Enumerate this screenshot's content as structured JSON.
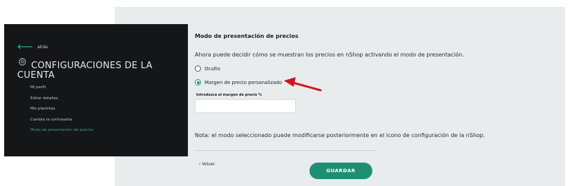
{
  "sidebar": {
    "back_label": "atrás",
    "title": "CONFIGURACIONES DE LA CUENTA",
    "menu": [
      {
        "label": "Mi perfil"
      },
      {
        "label": "Editar detalles"
      },
      {
        "label": "Mis plantillas"
      },
      {
        "label": "Cambia la contraseña"
      },
      {
        "label": "Modo de presentación de precios"
      }
    ],
    "active_index": 4
  },
  "main": {
    "section_title": "Modo de presentación de precios",
    "description": "Ahora puede decidir cómo se muestran los precios en nShop activando el modo de presentación.",
    "options": [
      {
        "label": "Oculto",
        "selected": false
      },
      {
        "label": "Margen de precio personalizado",
        "selected": true
      }
    ],
    "margin_field": {
      "label": "Introduzca el margen de precio %",
      "value": ""
    },
    "note": "Nota: el modo seleccionado puede modificarse posteriormente en el icono de configuración de la nShop.",
    "back_link": "Volver",
    "save_button": "GUARDAR"
  },
  "icons": {
    "back": "arrow-left-icon",
    "section": "gear-icon",
    "volver": "chevron-left-icon",
    "annotation": "red-pointer-arrow-icon"
  },
  "colors": {
    "accent": "#1f8f74",
    "sidebar_bg": "#141617",
    "content_bg": "#e8eced",
    "annotation": "#d0141b"
  }
}
